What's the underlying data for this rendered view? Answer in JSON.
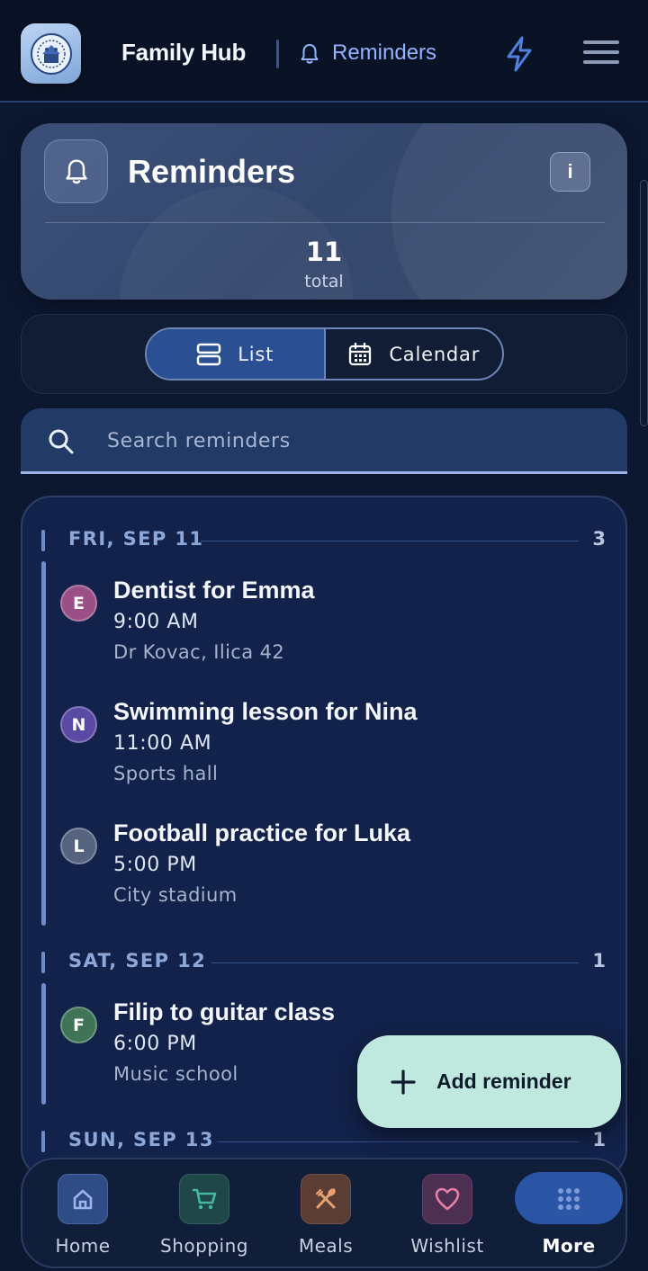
{
  "header": {
    "app_title": "Family Hub",
    "breadcrumb": "Reminders"
  },
  "hero": {
    "title": "Reminders",
    "info_label": "i",
    "total_count": "11",
    "total_label": "total"
  },
  "view_toggle": {
    "options": [
      {
        "label": "List",
        "active": true
      },
      {
        "label": "Calendar",
        "active": false
      }
    ]
  },
  "search": {
    "placeholder": "Search reminders",
    "value": ""
  },
  "groups": [
    {
      "day": "FRI, SEP 11",
      "count": "3",
      "items": [
        {
          "initial": "E",
          "title": "Dentist for Emma",
          "time": "9:00 AM",
          "place": "Dr Kovac, Ilica 42",
          "color": "#9a4f86"
        },
        {
          "initial": "N",
          "title": "Swimming lesson for Nina",
          "time": "11:00 AM",
          "place": "Sports hall",
          "color": "#5a4aa3"
        },
        {
          "initial": "L",
          "title": "Football practice for Luka",
          "time": "5:00 PM",
          "place": "City stadium",
          "color": "#55637e"
        }
      ]
    },
    {
      "day": "SAT, SEP 12",
      "count": "1",
      "items": [
        {
          "initial": "F",
          "title": "Filip to guitar class",
          "time": "6:00 PM",
          "place": "Music school",
          "color": "#3f7556"
        }
      ]
    },
    {
      "day": "SUN, SEP 13",
      "count": "1",
      "items": []
    }
  ],
  "fab": {
    "label": "Add reminder"
  },
  "nav": [
    {
      "label": "Home",
      "icon": "home-icon",
      "color": "#2f4c86",
      "active": false
    },
    {
      "label": "Shopping",
      "icon": "cart-icon",
      "color": "#1f4747",
      "active": false
    },
    {
      "label": "Meals",
      "icon": "utensils-icon",
      "color": "#5a3d35",
      "active": false
    },
    {
      "label": "Wishlist",
      "icon": "heart-icon",
      "color": "#4d2f52",
      "active": false
    },
    {
      "label": "More",
      "icon": "grid-icon",
      "color": "#2b56a5",
      "active": true
    }
  ],
  "colors": {
    "accent": "#93b2ff",
    "fab": "#bfe8df",
    "active_tab": "#2a4f93"
  }
}
